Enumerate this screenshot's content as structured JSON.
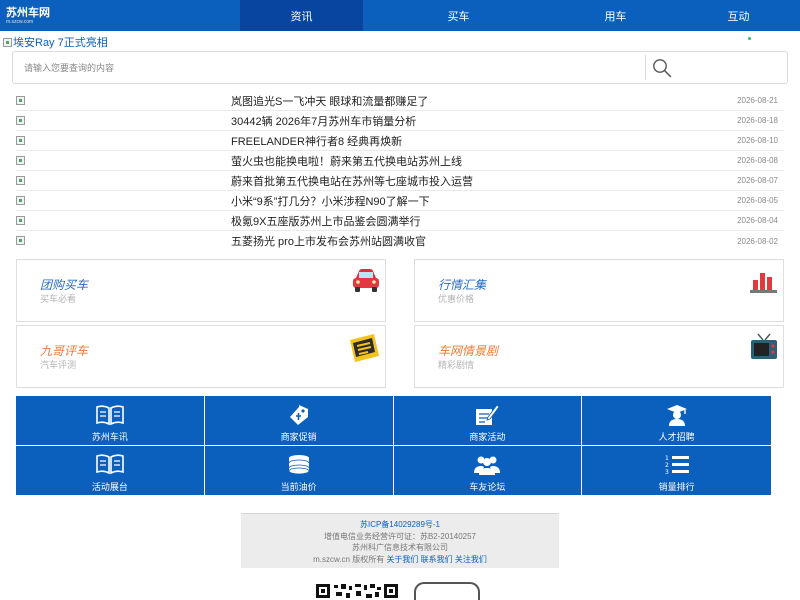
{
  "logo": {
    "text": "苏州车网",
    "sub": "m.szcw.com"
  },
  "nav": [
    {
      "label": "资讯",
      "active": true
    },
    {
      "label": "买车",
      "active": false
    },
    {
      "label": "用车",
      "active": false
    },
    {
      "label": "互动",
      "active": false
    }
  ],
  "banner": {
    "alt": "埃安Ray 7正式亮相"
  },
  "search": {
    "placeholder": "请输入您要查询的内容"
  },
  "news": [
    {
      "title": "岚图追光S一飞冲天 眼球和流量都赚足了",
      "date": "2026-08-21"
    },
    {
      "title": "30442辆 2026年7月苏州车市销量分析",
      "date": "2026-08-18"
    },
    {
      "title": "FREELANDER神行者8 经典再焕新",
      "date": "2026-08-10"
    },
    {
      "title": "萤火虫也能换电啦！蔚来第五代换电站苏州上线",
      "date": "2026-08-08"
    },
    {
      "title": "蔚来首批第五代换电站在苏州等七座城市投入运营",
      "date": "2026-08-07"
    },
    {
      "title": "小米“9系”打几分？小米涉程N90了解一下",
      "date": "2026-08-05"
    },
    {
      "title": "极氪9X五座版苏州上市品鉴会圆满举行",
      "date": "2026-08-04"
    },
    {
      "title": "五菱扬光 pro上市发布会苏州站圆满收官",
      "date": "2026-08-02"
    }
  ],
  "cards": [
    {
      "title": "团购买车",
      "sub": "买车必看",
      "color": "#2a6bc4",
      "icon": "car-icon"
    },
    {
      "title": "行情汇集",
      "sub": "优惠价格",
      "color": "#2a6bc4",
      "icon": "bar-chart-icon"
    },
    {
      "title": "九哥评车",
      "sub": "汽车评测",
      "color": "#ef7a35",
      "icon": "review-badge-icon"
    },
    {
      "title": "车网情景剧",
      "sub": "精彩剧情",
      "color": "#ef7a35",
      "icon": "tv-icon"
    }
  ],
  "grid": [
    {
      "label": "苏州车讯",
      "icon": "book-icon"
    },
    {
      "label": "商家促销",
      "icon": "tag-icon"
    },
    {
      "label": "商家活动",
      "icon": "edit-doc-icon"
    },
    {
      "label": "人才招聘",
      "icon": "graduate-icon"
    },
    {
      "label": "活动展台",
      "icon": "book-icon"
    },
    {
      "label": "当前油价",
      "icon": "coins-icon"
    },
    {
      "label": "车友论坛",
      "icon": "users-icon"
    },
    {
      "label": "销量排行",
      "icon": "ranked-list-icon"
    }
  ],
  "footer": {
    "icp": "苏ICP备14029289号-1",
    "license": "增值电信业务经营许可证：苏B2-20140257",
    "company": "苏州科广信息技术有限公司",
    "copyright": "m.szcw.cn 版权所有",
    "links": [
      "关于我们",
      "联系我们",
      "关注我们"
    ]
  }
}
